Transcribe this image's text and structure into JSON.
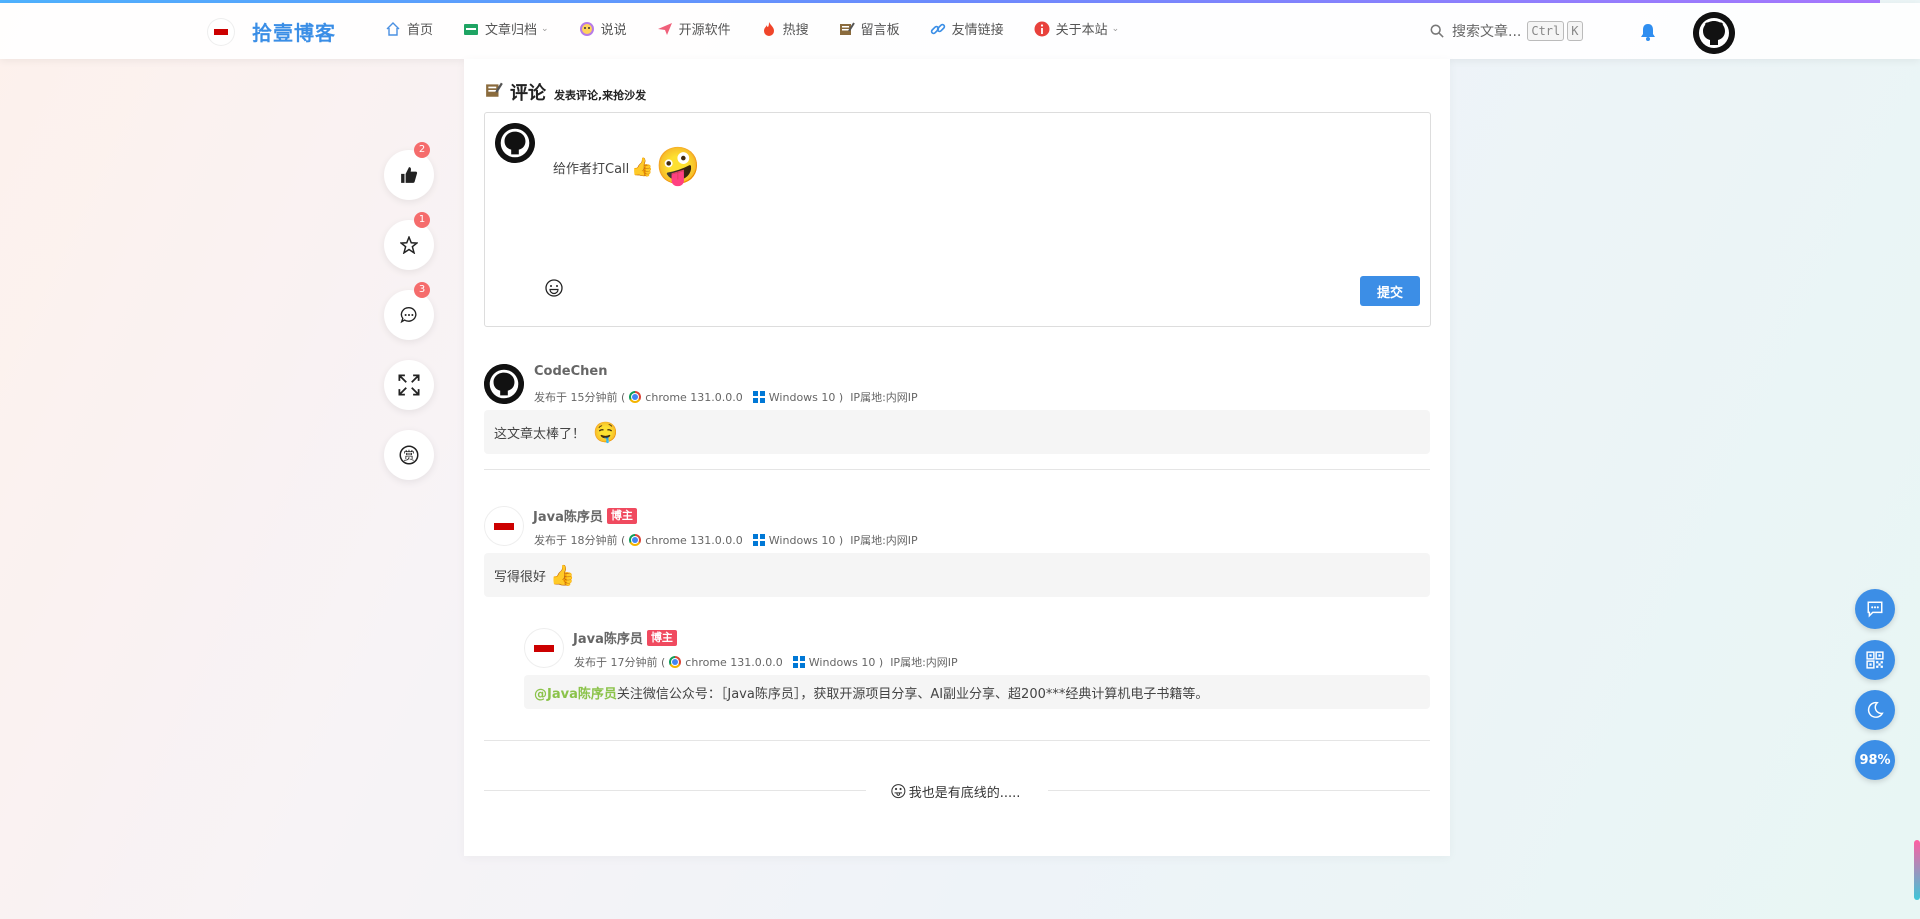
{
  "header": {
    "site_title": "拾壹博客",
    "nav": [
      {
        "label": "首页",
        "icon": "home-icon",
        "dropdown": false
      },
      {
        "label": "文章归档",
        "icon": "archive-icon",
        "dropdown": true
      },
      {
        "label": "说说",
        "icon": "talk-icon",
        "dropdown": false
      },
      {
        "label": "开源软件",
        "icon": "send-icon",
        "dropdown": false
      },
      {
        "label": "热搜",
        "icon": "fire-icon",
        "dropdown": false
      },
      {
        "label": "留言板",
        "icon": "message-board-icon",
        "dropdown": false
      },
      {
        "label": "友情链接",
        "icon": "link-icon",
        "dropdown": false
      },
      {
        "label": "关于本站",
        "icon": "info-icon",
        "dropdown": true
      }
    ],
    "search_placeholder": "搜索文章...",
    "shortcut_ctrl": "Ctrl",
    "shortcut_k": "K"
  },
  "side_actions": [
    {
      "name": "like",
      "icon": "thumbs-up-icon",
      "badge": "2"
    },
    {
      "name": "favorite",
      "icon": "star-icon",
      "badge": "1"
    },
    {
      "name": "comment",
      "icon": "comment-icon",
      "badge": "3"
    },
    {
      "name": "fullscreen",
      "icon": "fullscreen-icon",
      "badge": ""
    },
    {
      "name": "reward",
      "icon": "reward-icon",
      "badge": ""
    }
  ],
  "comments": {
    "title": "评论",
    "subtitle": "发表评论,来抢沙发",
    "editor_text": "给作者打Call",
    "submit_label": "提交",
    "items": [
      {
        "author": "CodeChen",
        "tag": "",
        "time": "发布于 15分钟前",
        "browser": "chrome 131.0.0.0",
        "os": "Windows 10",
        "ip": "IP属地:内网IP",
        "content": "这文章太棒了！",
        "mention": ""
      },
      {
        "author": "Java陈序员",
        "tag": "博主",
        "time": "发布于 18分钟前",
        "browser": "chrome 131.0.0.0",
        "os": "Windows 10",
        "ip": "IP属地:内网IP",
        "content": "写得很好",
        "mention": ""
      },
      {
        "author": "Java陈序员",
        "tag": "博主",
        "time": "发布于 17分钟前",
        "browser": "chrome 131.0.0.0",
        "os": "Windows 10",
        "ip": "IP属地:内网IP",
        "content": "关注微信公众号：［Java陈序员］，获取开源项目分享、AI副业分享、超200***经典计算机电子书籍等。",
        "mention": "@Java陈序员"
      }
    ],
    "bottom_text": "我也是有底线的....."
  },
  "float_buttons": {
    "percent": "98%"
  },
  "colors": {
    "accent": "#3c8ee6",
    "tag": "#f04a5f",
    "mention": "#8bc34a",
    "badge": "#f56c6c"
  }
}
